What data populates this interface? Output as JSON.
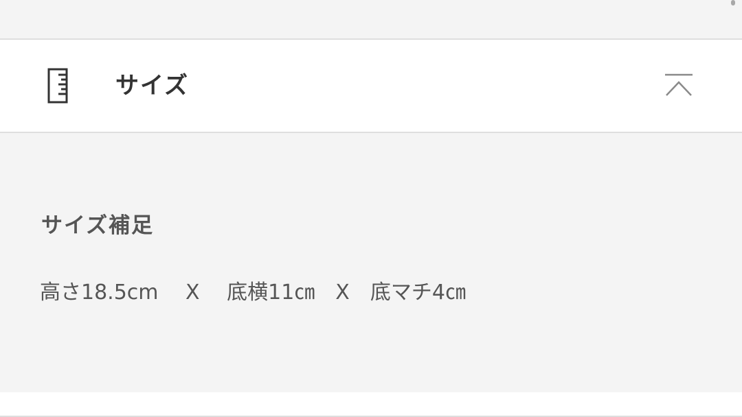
{
  "section": {
    "title": "サイズ",
    "icon": "ruler-icon",
    "toggle_icon": "chevron-up-icon"
  },
  "content": {
    "subheading": "サイズ補足",
    "detail": "高さ18.5cm　 X 　底横11㎝　X　底マチ4㎝"
  },
  "colors": {
    "background": "#f4f4f4",
    "panel": "#ffffff",
    "divider": "#dedede",
    "title_text": "#333333",
    "body_text": "#555555"
  }
}
